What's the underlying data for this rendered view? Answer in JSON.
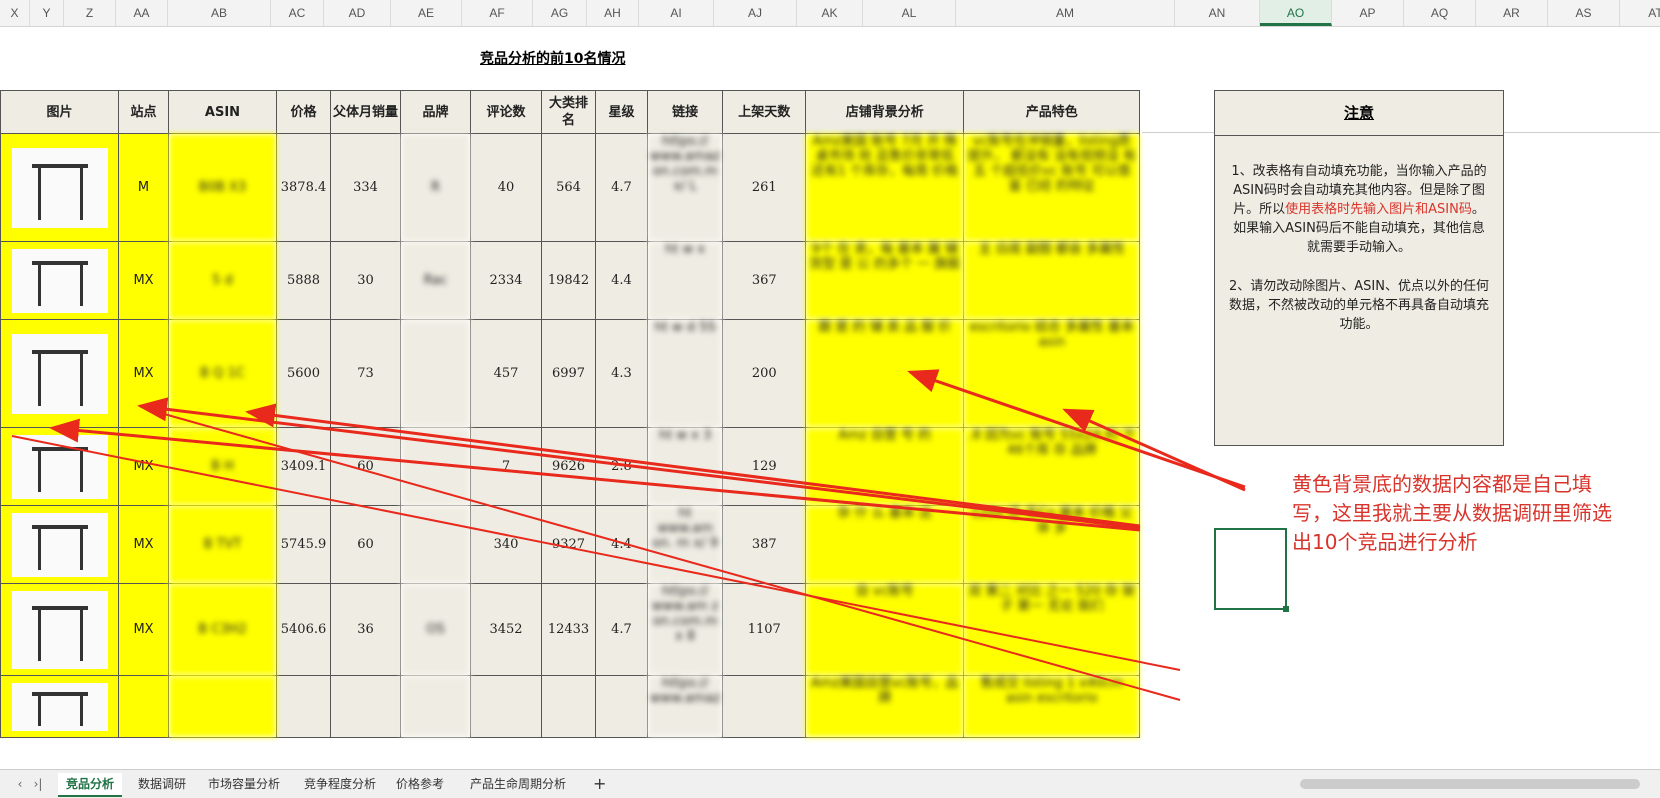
{
  "columns": [
    "X",
    "Y",
    "Z",
    "AA",
    "AB",
    "AC",
    "AD",
    "AE",
    "AF",
    "AG",
    "AH",
    "AI",
    "AJ",
    "AK",
    "AL",
    "AM",
    "AN",
    "AO",
    "AP",
    "AQ",
    "AR",
    "AS",
    "AT"
  ],
  "selected_column": "AO",
  "title": "竞品分析的前10名情况",
  "table": {
    "headers": [
      "图片",
      "站点",
      "ASIN",
      "价格",
      "父体月销量",
      "品牌",
      "评论数",
      "大类排名",
      "星级",
      "链接",
      "上架天数",
      "店铺背景分析",
      "产品特色"
    ],
    "rows": [
      {
        "site": "M",
        "asin": "B0B X3",
        "price": "3878.4",
        "sales": "334",
        "brand": "R",
        "reviews": "40",
        "rank": "564",
        "stars": "4.7",
        "link": "https:// www.amaz on.com.m x/ L",
        "days": "261",
        "shop": "Amz美国 账号 7月 开 降桌市场 抢 且售价非常低 还有1 个库存，每周 价格",
        "feature": "vc账号在冲销量，listing质 提升， 都没有 没有视频没 有五 个超低价vc 账号 可以借 鉴 已经 的特征"
      },
      {
        "site": "MX",
        "asin": "5 d",
        "price": "5888",
        "sales": "30",
        "brand": "Rac",
        "reviews": "2334",
        "rank": "19842",
        "stars": "4.4",
        "link": "ht w x",
        "days": "367",
        "shop": "9个 在 卖，每 基本 属 铺货型 是 公 的多个 一 旗舰",
        "feature": "主 白底 副图 都会 多属性"
      },
      {
        "site": "MX",
        "asin": "B Q 1C",
        "price": "5600",
        "sales": "73",
        "brand": "",
        "reviews": "457",
        "rank": "6997",
        "stars": "4.3",
        "link": "ht w d 5S",
        "days": "200",
        "shop": "跟 是 的 铺 卖 品 服 价",
        "feature": "escritorio 结合 多属性 基本 asin"
      },
      {
        "site": "MX",
        "asin": "B H",
        "price": "3409.1",
        "sales": "60",
        "brand": "",
        "reviews": "7",
        "rank": "9626",
        "stars": "2.8",
        "link": "ht w x 3",
        "days": "129",
        "shop": "Amz 自营 号 的",
        "feature": ".8 因为vc 账号 55x24 的 下46个库 存 品牌"
      },
      {
        "site": "MX",
        "asin": "B TVT",
        "price": "5745.9",
        "sales": "60",
        "brand": "",
        "reviews": "340",
        "rank": "9327",
        "stars": "4.4",
        "link": "ht www.am on. m x/ 9",
        "days": "387",
        "shop": "杂 什 么 基本 这",
        "feature": "120x 还 无Co 基本 价格 父体 多"
      },
      {
        "site": "MX",
        "asin": "B C3H2",
        "price": "5406.6",
        "sales": "36",
        "brand": "OS",
        "reviews": "3452",
        "rank": "12433",
        "stars": "4.7",
        "link": "https:// www.am z on.com.m x 8",
        "days": "1107",
        "shop": "自 vc账号",
        "feature": "双 第二 对比 之一 520 存 架子 第一 无论 我们"
      },
      {
        "site": "",
        "asin": "",
        "price": "",
        "sales": "",
        "brand": "",
        "reviews": "",
        "rank": "",
        "stars": "",
        "link": "https:// www.amaz",
        "days": "",
        "shop": "Amz美国自营vc账号，品牌",
        "feature": "售成交 listing 1 x40cm asin escritorio"
      }
    ]
  },
  "notice": {
    "title": "注意",
    "p1_before": "1、改表格有自动填充功能，当你输入产品的ASIN码时会自动填充其他内容。但是除了图片。所以",
    "p1_red": "使用表格时先输入图片和ASIN码",
    "p1_after": "。如果输入ASIN码后不能自动填充，其他信息就需要手动输入。",
    "p2": "2、请勿改动除图片、ASIN、优点以外的任何数据，不然被改动的单元格不再具备自动填充功能。"
  },
  "annotation": "黄色背景底的数据内容都是自己填写，这里我就主要从数据调研里筛选出10个竞品进行分析",
  "sheet_tabs": [
    "竞品分析",
    "数据调研",
    "市场容量分析",
    "竞争程度分析",
    "价格参考",
    "产品生命周期分析"
  ],
  "active_tab": "竞品分析",
  "add_tab_label": "+",
  "colors": {
    "yellow": "#ffff00",
    "beige": "#efede3",
    "red": "#d9342b",
    "excel_green": "#217346"
  }
}
